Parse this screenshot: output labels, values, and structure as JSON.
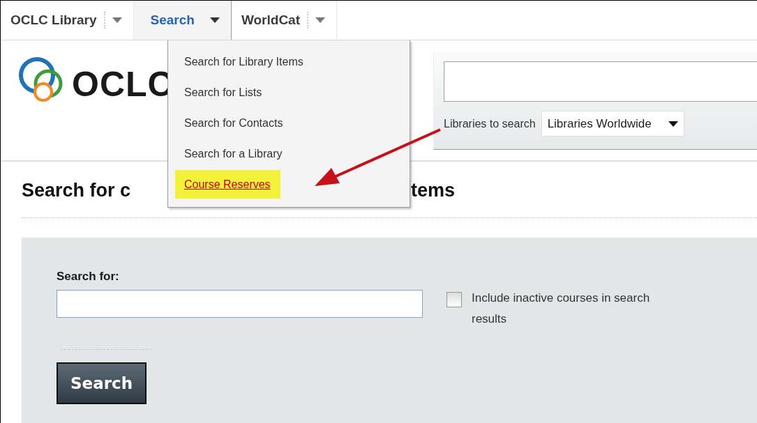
{
  "nav": {
    "tabs": [
      {
        "label": "OCLC Library",
        "selected": false
      },
      {
        "label": "Search",
        "selected": true
      },
      {
        "label": "WorldCat",
        "selected": false
      }
    ]
  },
  "logo": {
    "text": "OCLC"
  },
  "menu": {
    "items": [
      {
        "label": "Search for Library Items",
        "selected": false
      },
      {
        "label": "Search for Lists",
        "selected": false
      },
      {
        "label": "Search for Contacts",
        "selected": false
      },
      {
        "label": "Search for a Library",
        "selected": false
      },
      {
        "label": "Course Reserves",
        "selected": true
      }
    ]
  },
  "search_panel": {
    "libraries_label": "Libraries to search",
    "libraries_select": "Libraries Worldwide"
  },
  "heading_parts": [
    "Search for c",
    "tems"
  ],
  "form": {
    "search_label": "Search for:",
    "include_inactive": {
      "label": "Include inactive courses in search results",
      "checked": false
    },
    "search_button": "Search"
  }
}
